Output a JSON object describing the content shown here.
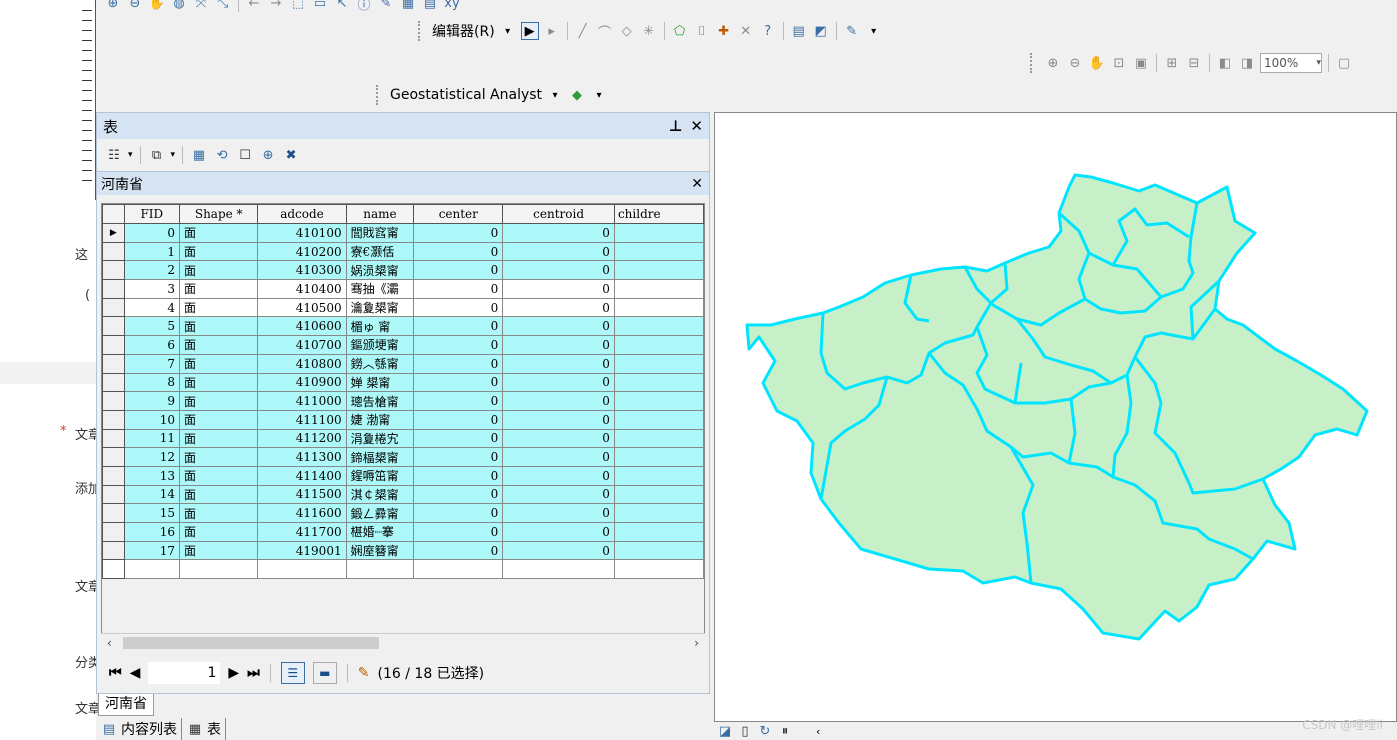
{
  "toolbars": {
    "editor_label": "编辑器(R)",
    "geostat_label": "Geostatistical Analyst",
    "zoom_value": "100%"
  },
  "table_window": {
    "title": "表",
    "layer_tab_title": "河南省",
    "columns": [
      "FID",
      "Shape *",
      "adcode",
      "name",
      "center",
      "centroid",
      "childre"
    ],
    "rows": [
      {
        "fid": "0",
        "shape": "面",
        "adcode": "410100",
        "name": "閭戝窞甯",
        "center": "0",
        "centroid": "0",
        "selected": true
      },
      {
        "fid": "1",
        "shape": "面",
        "adcode": "410200",
        "name": "寮€灏佸",
        "center": "0",
        "centroid": "0",
        "selected": true
      },
      {
        "fid": "2",
        "shape": "面",
        "adcode": "410300",
        "name": "娲涢槼甯",
        "center": "0",
        "centroid": "0",
        "selected": true
      },
      {
        "fid": "3",
        "shape": "面",
        "adcode": "410400",
        "name": "骞抽《灞",
        "center": "0",
        "centroid": "0",
        "selected": false
      },
      {
        "fid": "4",
        "shape": "面",
        "adcode": "410500",
        "name": "瀹夐槼甯",
        "center": "0",
        "centroid": "0",
        "selected": false
      },
      {
        "fid": "5",
        "shape": "面",
        "adcode": "410600",
        "name": "楣ゅ 甯",
        "center": "0",
        "centroid": "0",
        "selected": true
      },
      {
        "fid": "6",
        "shape": "面",
        "adcode": "410700",
        "name": "鏂颁埂甯",
        "center": "0",
        "centroid": "0",
        "selected": true
      },
      {
        "fid": "7",
        "shape": "面",
        "adcode": "410800",
        "name": "鐒︿綔甯",
        "center": "0",
        "centroid": "0",
        "selected": true
      },
      {
        "fid": "8",
        "shape": "面",
        "adcode": "410900",
        "name": "婵   槼甯",
        "center": "0",
        "centroid": "0",
        "selected": true
      },
      {
        "fid": "9",
        "shape": "面",
        "adcode": "411000",
        "name": "璁告槍甯",
        "center": "0",
        "centroid": "0",
        "selected": true
      },
      {
        "fid": "10",
        "shape": "面",
        "adcode": "411100",
        "name": "婕   渤甯",
        "center": "0",
        "centroid": "0",
        "selected": true
      },
      {
        "fid": "11",
        "shape": "面",
        "adcode": "411200",
        "name": "涓夐棬宄",
        "center": "0",
        "centroid": "0",
        "selected": true
      },
      {
        "fid": "12",
        "shape": "面",
        "adcode": "411300",
        "name": "鍗楅槼甯",
        "center": "0",
        "centroid": "0",
        "selected": true
      },
      {
        "fid": "13",
        "shape": "面",
        "adcode": "411400",
        "name": "鍟嗕笜甯",
        "center": "0",
        "centroid": "0",
        "selected": true
      },
      {
        "fid": "14",
        "shape": "面",
        "adcode": "411500",
        "name": "淇￠槼甯",
        "center": "0",
        "centroid": "0",
        "selected": true
      },
      {
        "fid": "15",
        "shape": "面",
        "adcode": "411600",
        "name": "鍛ㄥ彛甯",
        "center": "0",
        "centroid": "0",
        "selected": true
      },
      {
        "fid": "16",
        "shape": "面",
        "adcode": "411700",
        "name": "椹婚┈搴",
        "center": "0",
        "centroid": "0",
        "selected": true
      },
      {
        "fid": "17",
        "shape": "面",
        "adcode": "419001",
        "name": "娴庢簮甯",
        "center": "0",
        "centroid": "0",
        "selected": true
      }
    ],
    "record_number": "1",
    "selection_status": "(16 / 18 已选择)"
  },
  "bottom_tabs": {
    "doc_tab": "河南省",
    "toc_tab": "内容列表",
    "table_tab": "表"
  },
  "web_bg": {
    "labels": [
      "这",
      "(",
      "文章",
      "添加",
      "文章",
      "分类",
      "文章"
    ]
  },
  "watermark": "CSDN @哩哩li",
  "colors": {
    "selected_row": "#adf9f9",
    "map_fill": "#c8f0c8",
    "map_outline": "#00e5ff"
  }
}
